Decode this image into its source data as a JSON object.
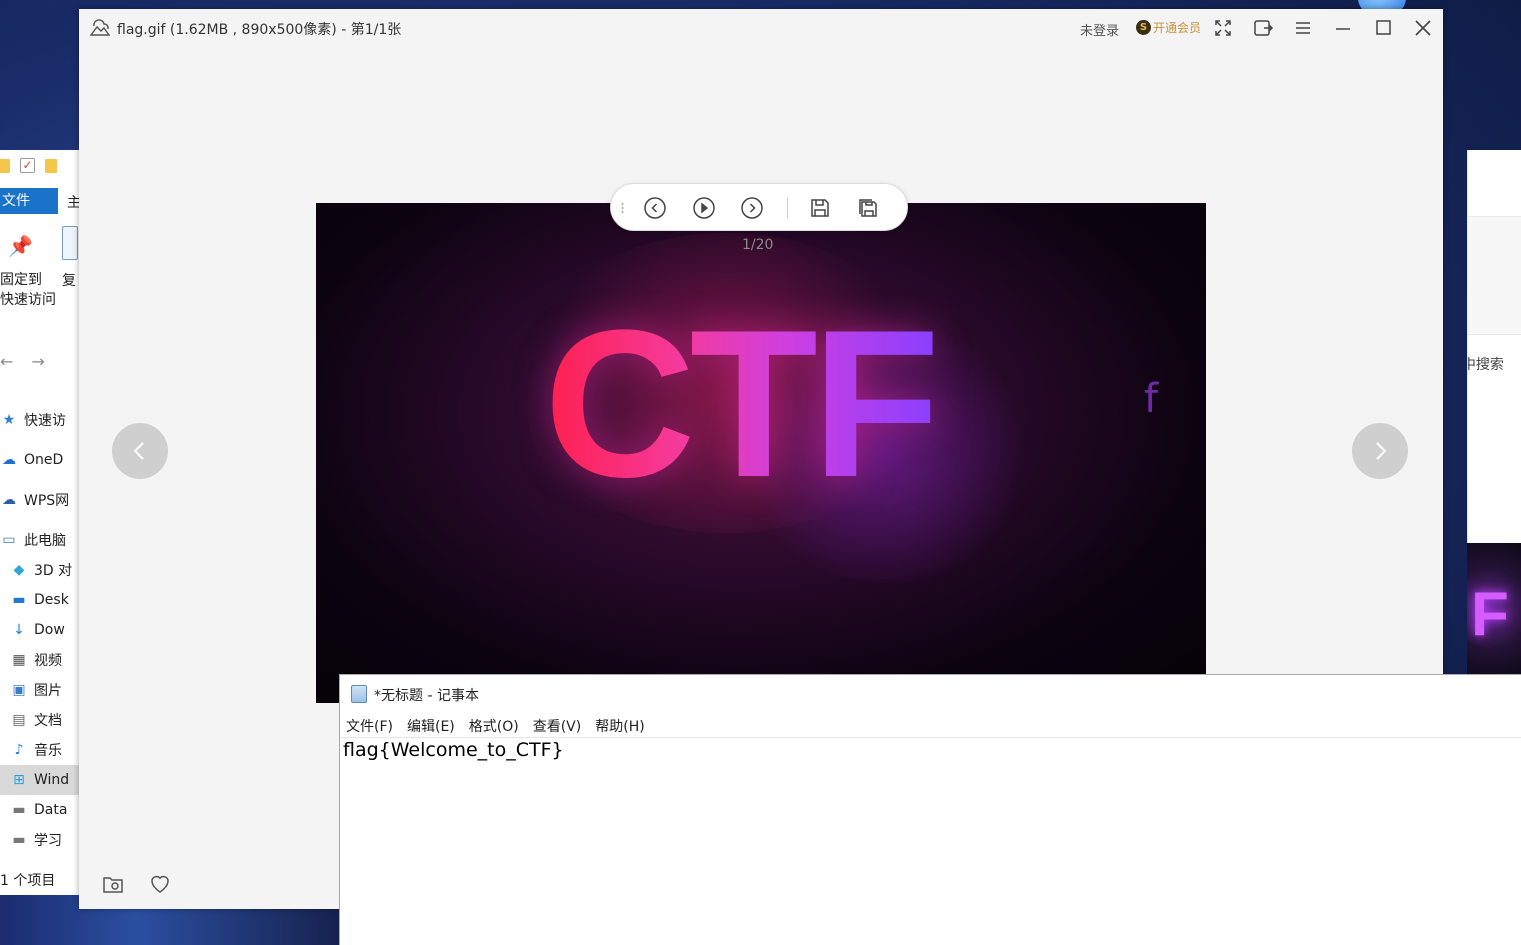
{
  "viewer": {
    "title": "flag.gif (1.62MB , 890x500像素) - 第1/1张",
    "login_status": "未登录",
    "vip_icon": "S",
    "vip_label": "开通会员",
    "image_text": "CTF",
    "image_overlay_char": "f",
    "frame_counter": "1/20",
    "icons": {
      "logo": "cloud-photo-icon",
      "fullscreen": "fullscreen-icon",
      "share": "share-icon",
      "menu": "menu-icon",
      "minimize": "minimize-icon",
      "maximize": "maximize-icon",
      "close": "close-icon",
      "prev_frame": "prev-frame-icon",
      "play": "play-icon",
      "next_frame": "next-frame-icon",
      "save_frame": "save-frame-icon",
      "save_all_frames": "save-all-frames-icon",
      "prev_image": "prev-image-icon",
      "next_image": "next-image-icon",
      "open_folder": "folder-icon",
      "favorite": "heart-icon"
    }
  },
  "notepad": {
    "title": "*无标题 - 记事本",
    "menu": [
      "文件(F)",
      "编辑(E)",
      "格式(O)",
      "查看(V)",
      "帮助(H)"
    ],
    "content": "flag{Welcome_to_CTF}"
  },
  "explorer": {
    "file_tab": "文件",
    "home_tab": "主",
    "pin_label_1": "固定到",
    "pin_label_2": "快速访问",
    "copy_label": "复",
    "tree": [
      {
        "icon": "star-icon",
        "label": "快速访"
      },
      {
        "icon": "onedrive-icon",
        "label": "OneD"
      },
      {
        "icon": "wps-cloud-icon",
        "label": "WPS网"
      },
      {
        "icon": "this-pc-icon",
        "label": "此电脑"
      },
      {
        "icon": "3d-objects-icon",
        "label": "3D 对"
      },
      {
        "icon": "desktop-icon",
        "label": "Desk"
      },
      {
        "icon": "downloads-icon",
        "label": "Dow"
      },
      {
        "icon": "videos-icon",
        "label": "视频"
      },
      {
        "icon": "pictures-icon",
        "label": "图片"
      },
      {
        "icon": "documents-icon",
        "label": "文档"
      },
      {
        "icon": "music-icon",
        "label": "音乐"
      },
      {
        "icon": "windows-drive-icon",
        "label": "Wind"
      },
      {
        "icon": "drive-icon",
        "label": "Data"
      },
      {
        "icon": "drive-icon",
        "label": "学习"
      }
    ],
    "status": "1 个项目",
    "right_search": "中搜索"
  }
}
